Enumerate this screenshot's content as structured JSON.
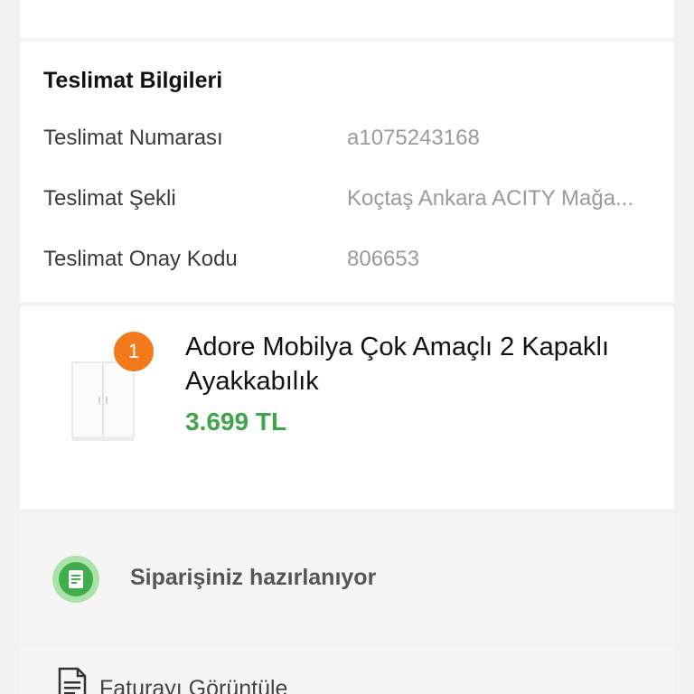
{
  "delivery": {
    "title": "Teslimat Bilgileri",
    "rows": [
      {
        "label": "Teslimat Numarası",
        "value": "a1075243168"
      },
      {
        "label": "Teslimat Şekli",
        "value": "Koçtaş Ankara ACITY Mağa..."
      },
      {
        "label": "Teslimat Onay Kodu",
        "value": "806653"
      }
    ]
  },
  "product": {
    "quantity": "1",
    "name": "Adore Mobilya Çok Amaçlı 2 Kapaklı Ayakkabılık",
    "price": "3.699 TL"
  },
  "status": {
    "text": "Siparişiniz hazırlanıyor",
    "icon": "document-check-icon",
    "color": "#3fae4a"
  },
  "invoice": {
    "label": "Faturayı Görüntüle",
    "icon": "invoice-icon"
  },
  "colors": {
    "accent_orange": "#f27a1a",
    "price_green": "#3ea54a"
  }
}
